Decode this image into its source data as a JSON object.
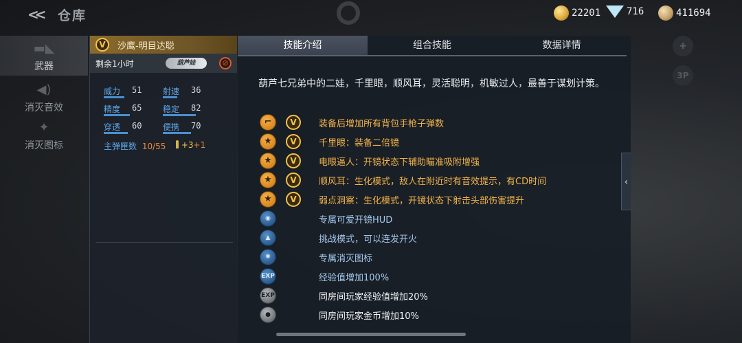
{
  "header": {
    "back_icon": "double-chevron-left-icon",
    "title": "仓库",
    "currencies": [
      {
        "icon": "gold-crown-icon",
        "value": "22201"
      },
      {
        "icon": "diamond-icon",
        "value": "716"
      },
      {
        "icon": "coin-icon",
        "value": "411694"
      }
    ]
  },
  "sidebar": {
    "items": [
      {
        "label": "武器",
        "icon": "rifle-icon",
        "active": true
      },
      {
        "label": "消灭音效",
        "icon": "speaker-icon",
        "active": false
      },
      {
        "label": "消灭图标",
        "icon": "skull-emblem-icon",
        "active": false
      }
    ]
  },
  "weapon": {
    "badge": "V",
    "name": "沙鹰-明目达聪",
    "remaining": "剩余1小时",
    "tag": "葫芦娃",
    "stats": [
      {
        "name": "威力",
        "value": "51",
        "level": 0.51
      },
      {
        "name": "射速",
        "value": "36",
        "level": 0.36
      },
      {
        "name": "精度",
        "value": "65",
        "level": 0.65
      },
      {
        "name": "稳定",
        "value": "82",
        "level": 0.82
      },
      {
        "name": "穿透",
        "value": "60",
        "level": 0.6
      },
      {
        "name": "便携",
        "value": "70",
        "level": 0.7
      }
    ],
    "ammo_label": "主弹匣数",
    "ammo_current": "10",
    "ammo_sep": "/",
    "ammo_total": "55",
    "ammo_bonus_a": "+3",
    "ammo_bonus_b": "+1"
  },
  "tabs": [
    {
      "label": "技能介绍",
      "active": true
    },
    {
      "label": "组合技能",
      "active": false
    },
    {
      "label": "数据详情",
      "active": false
    }
  ],
  "description": "葫芦七兄弟中的二娃，千里眼，顺风耳，灵活聪明，机敏过人，最善于谋划计策。",
  "skills": [
    {
      "icon": "pistol-icon",
      "badge": "V",
      "text": "装备后增加所有背包手枪子弹数",
      "color": "gold"
    },
    {
      "icon": "star-icon",
      "badge": "V",
      "text": "千里眼：装备二倍镜",
      "color": "gold"
    },
    {
      "icon": "star-icon",
      "badge": "V",
      "text": "电眼逼人：开镜状态下辅助瞄准吸附增强",
      "color": "gold"
    },
    {
      "icon": "star-icon",
      "badge": "V",
      "text": "顺风耳：生化模式，敌人在附近时有音效提示，有CD时间",
      "color": "gold"
    },
    {
      "icon": "star-icon",
      "badge": "V",
      "text": "弱点洞察：生化模式，开镜状态下射击头部伤害提升",
      "color": "gold"
    },
    {
      "icon": "scope-hud-icon",
      "badge": "",
      "text": "专属可爱开镜HUD",
      "color": "blue"
    },
    {
      "icon": "challenge-icon",
      "badge": "",
      "text": "挑战模式，可以连发开火",
      "color": "blue"
    },
    {
      "icon": "kill-icon",
      "badge": "",
      "text": "专属消灭图标",
      "color": "blue"
    },
    {
      "icon": "exp-icon",
      "badge": "",
      "text": "经验值增加100%",
      "color": "blue"
    },
    {
      "icon": "room-exp-icon",
      "badge": "",
      "text": "同房间玩家经验值增加20%",
      "color": "white"
    },
    {
      "icon": "room-gold-icon",
      "badge": "",
      "text": "同房间玩家金币增加10%",
      "color": "white"
    }
  ],
  "right_buttons": [
    {
      "icon": "gamepad-icon",
      "label": ""
    },
    {
      "icon": "third-person-icon",
      "label": "3P"
    }
  ]
}
